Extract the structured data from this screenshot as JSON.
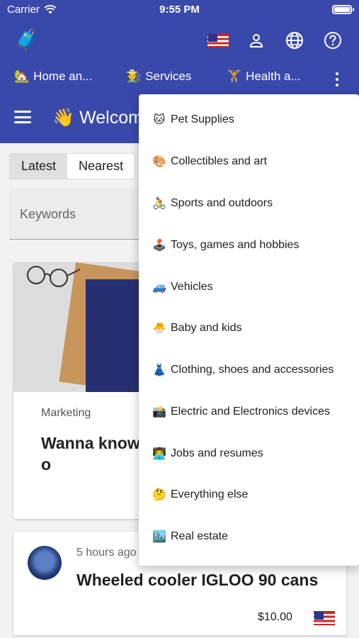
{
  "status_bar": {
    "carrier": "Carrier",
    "time": "9:55 PM"
  },
  "header": {
    "logo_icon": "🧳",
    "actions": [
      {
        "name": "country-flag",
        "icon": "us-flag-icon"
      },
      {
        "name": "account",
        "icon": "user-icon"
      },
      {
        "name": "language",
        "icon": "globe-icon"
      },
      {
        "name": "help",
        "icon": "question-circle-icon"
      }
    ]
  },
  "category_tabs": [
    {
      "emoji": "🏡",
      "label": "Home an..."
    },
    {
      "emoji": "🧑‍🌾",
      "label": "Services"
    },
    {
      "emoji": "🏋",
      "label": "Health a..."
    }
  ],
  "welcome": {
    "emoji": "👋",
    "text": "Welcom"
  },
  "sort_tabs": {
    "latest": "Latest",
    "nearest": "Nearest",
    "selected": "Latest"
  },
  "search": {
    "placeholder": "Keywords"
  },
  "post1": {
    "category": "Marketing",
    "title": "Wanna know are selling o"
  },
  "post2": {
    "time_ago": "5 hours ago",
    "title": "Wheeled cooler IGLOO 90 cans",
    "price": "$10.00"
  },
  "dropdown_menu": [
    {
      "emoji": "🐱",
      "label": "Pet Supplies"
    },
    {
      "emoji": "🎨",
      "label": "Collectibles and art"
    },
    {
      "emoji": "🚴",
      "label": "Sports and outdoors"
    },
    {
      "emoji": "🕹️",
      "label": "Toys, games and hobbies"
    },
    {
      "emoji": "🚙",
      "label": "Vehicles"
    },
    {
      "emoji": "🐣",
      "label": "Baby and kids"
    },
    {
      "emoji": "👗",
      "label": "Clothing, shoes and accessories"
    },
    {
      "emoji": "📸",
      "label": "Electric and Electronics devices"
    },
    {
      "emoji": "👨‍💻",
      "label": "Jobs and resumes"
    },
    {
      "emoji": "🤔",
      "label": "Everything else"
    },
    {
      "emoji": "🏙️",
      "label": "Real estate"
    }
  ],
  "colors": {
    "primary": "#3949ab",
    "background": "#f2f2f2",
    "card": "#ffffff"
  }
}
